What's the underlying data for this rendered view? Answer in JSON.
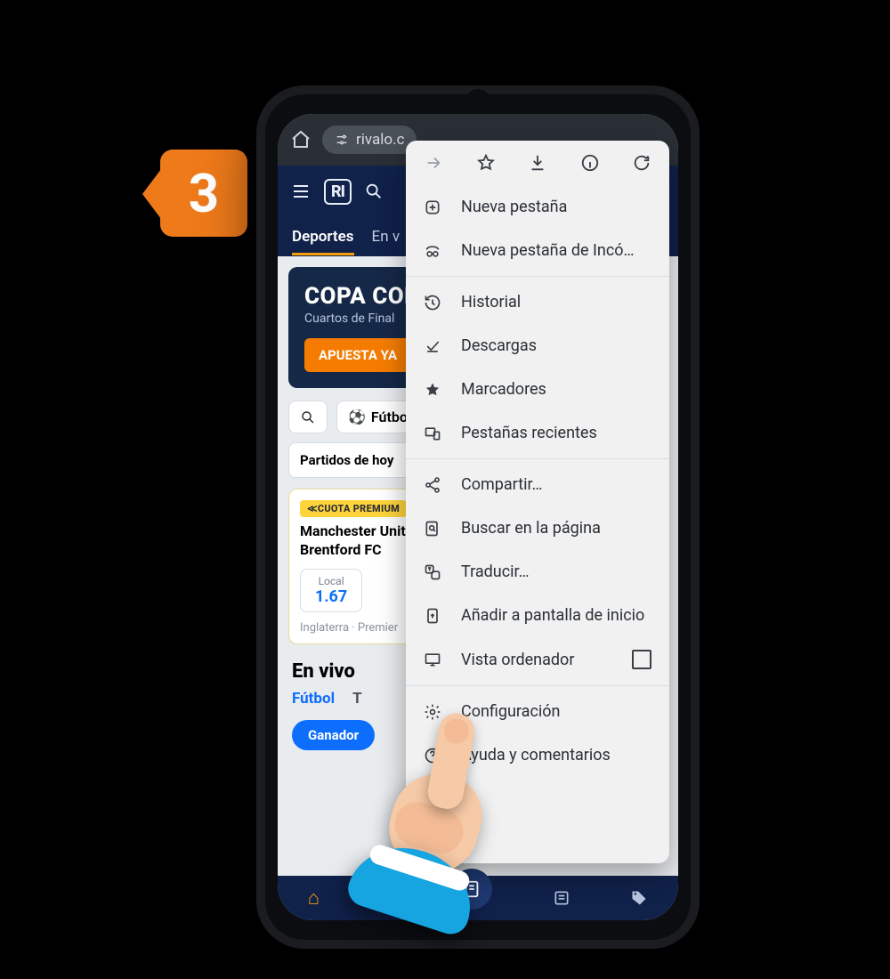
{
  "step": {
    "number": "3"
  },
  "browser": {
    "url_text": "rivalo.c",
    "menu_top_icons": [
      "forward",
      "star",
      "download",
      "info",
      "refresh"
    ],
    "menu": [
      {
        "icon": "plus",
        "label": "Nueva pestaña"
      },
      {
        "icon": "incognito",
        "label": "Nueva pestaña de Incó…"
      },
      {
        "sep": true
      },
      {
        "icon": "history",
        "label": "Historial"
      },
      {
        "icon": "check-down",
        "label": "Descargas"
      },
      {
        "icon": "star-fill",
        "label": "Marcadores"
      },
      {
        "icon": "devices",
        "label": "Pestañas recientes"
      },
      {
        "sep": true
      },
      {
        "icon": "share",
        "label": "Compartir…"
      },
      {
        "icon": "find",
        "label": "Buscar en la página"
      },
      {
        "icon": "translate",
        "label": "Traducir…"
      },
      {
        "icon": "add-home",
        "label": "Añadir a pantalla de inicio"
      },
      {
        "icon": "desktop",
        "label": "Vista ordenador",
        "checkbox": true
      },
      {
        "sep": true
      },
      {
        "icon": "gear",
        "label": "Configuración"
      },
      {
        "icon": "help",
        "label": "Ayuda y comentarios"
      }
    ]
  },
  "site": {
    "logo": "RI",
    "tabs": [
      {
        "label": "Deportes",
        "active": true
      },
      {
        "label": "En v"
      }
    ],
    "hero": {
      "title": "COPA COLO",
      "subtitle": "Cuartos de Final",
      "cta": "APUESTA YA"
    },
    "filters": {
      "sport": "Fútbol"
    },
    "today_label": "Partidos de hoy",
    "premium_label": "CUOTA PREMIUM",
    "match": {
      "team1": "Manchester Unit",
      "team2": "Brentford FC",
      "odds_label": "Local",
      "odds_value": "1.67",
      "meta": "Inglaterra · Premier"
    },
    "live": {
      "title": "En vivo",
      "tabs": [
        {
          "label": "Fútbol",
          "active": true
        },
        {
          "label": "T"
        }
      ],
      "winner": "Ganador"
    }
  }
}
